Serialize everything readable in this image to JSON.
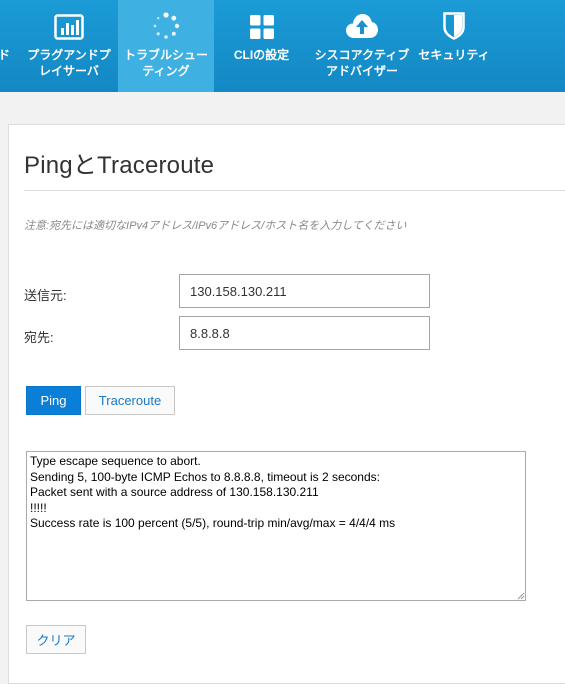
{
  "nav": {
    "items": [
      {
        "label": "ド",
        "icon": "dashboard-icon",
        "active": false
      },
      {
        "label": "プラグアンドプ\nレイサーバ",
        "icon": "bar-chart-icon",
        "active": false
      },
      {
        "label": "トラブルシュー\nティング",
        "icon": "spinner-icon",
        "active": true
      },
      {
        "label": "CLIの設定",
        "icon": "grid-icon",
        "active": false
      },
      {
        "label": "シスコアクティブ\nアドバイザー",
        "icon": "cloud-upload-icon",
        "active": false
      },
      {
        "label": "セキュリティ",
        "icon": "shield-icon",
        "active": false
      }
    ]
  },
  "page": {
    "title": "PingとTraceroute",
    "note": "注意:宛先には適切なIPv4アドレス/IPv6アドレス/ホスト名を入力してください"
  },
  "form": {
    "source_label": "送信元:",
    "source_value": "130.158.130.211",
    "dest_label": "宛先:",
    "dest_value": "8.8.8.8"
  },
  "actions": {
    "ping_label": "Ping",
    "traceroute_label": "Traceroute",
    "clear_label": "クリア"
  },
  "output": {
    "text": "Type escape sequence to abort.\nSending 5, 100-byte ICMP Echos to 8.8.8.8, timeout is 2 seconds:\nPacket sent with a source address of 130.158.130.211\n!!!!!\nSuccess rate is 100 percent (5/5), round-trip min/avg/max = 4/4/4 ms"
  },
  "colors": {
    "nav_bg": "#1388c4",
    "nav_active": "#3fb0e2",
    "primary": "#0b7fd8"
  }
}
